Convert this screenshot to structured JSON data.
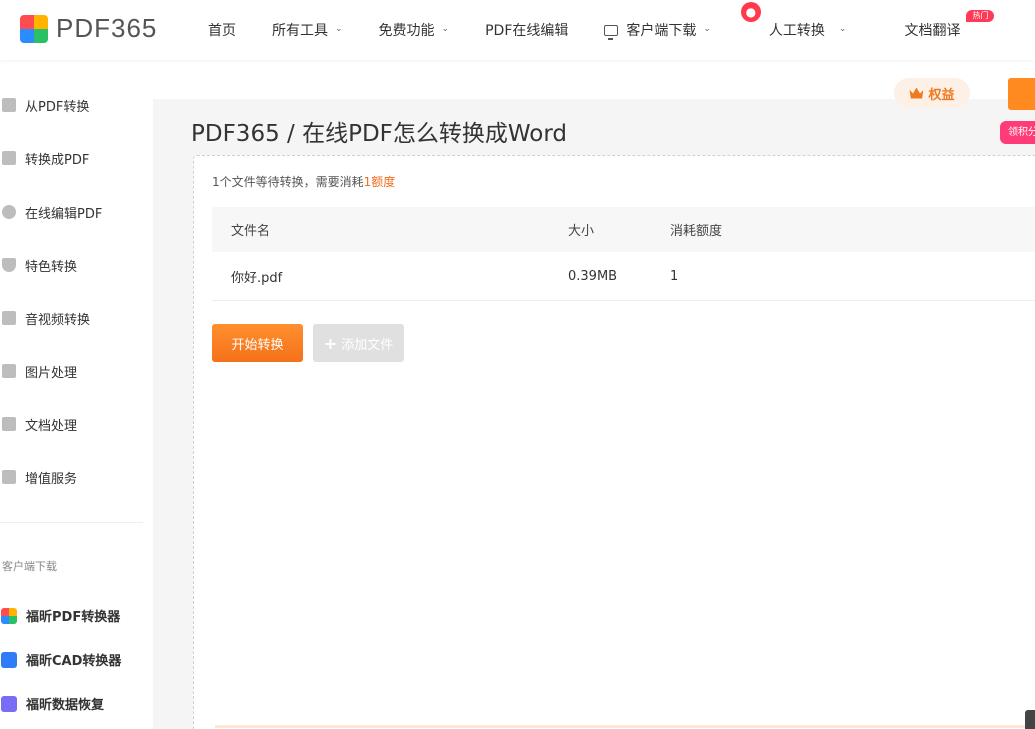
{
  "header": {
    "logo_text": "PDF365",
    "nav": [
      {
        "label": "首页",
        "chevron": false
      },
      {
        "label": "所有工具",
        "chevron": true
      },
      {
        "label": "免费功能",
        "chevron": true
      },
      {
        "label": "PDF在线编辑",
        "chevron": false
      },
      {
        "label": "客户端下载",
        "chevron": true
      },
      {
        "label": "人工转换",
        "chevron": true
      },
      {
        "label": "文档翻译",
        "chevron": false
      }
    ],
    "hot_badge": "热门"
  },
  "sidebar": {
    "items": [
      {
        "label": "从PDF转换",
        "icon": "pdf-convert-icon"
      },
      {
        "label": "转换成PDF",
        "icon": "to-pdf-icon"
      },
      {
        "label": "在线编辑PDF",
        "icon": "edit-pdf-icon"
      },
      {
        "label": "特色转换",
        "icon": "shield-icon"
      },
      {
        "label": "音视频转换",
        "icon": "media-icon"
      },
      {
        "label": "图片处理",
        "icon": "image-icon"
      },
      {
        "label": "文档处理",
        "icon": "document-icon"
      },
      {
        "label": "增值服务",
        "icon": "list-icon"
      }
    ],
    "download_section": "客户端下载",
    "apps": [
      {
        "label": "福昕PDF转换器",
        "icon": "pdf-converter-app-icon"
      },
      {
        "label": "福昕CAD转换器",
        "icon": "cad-converter-app-icon"
      },
      {
        "label": "福昕数据恢复",
        "icon": "data-recovery-app-icon"
      }
    ]
  },
  "top_actions": {
    "quanyi_label": "权益",
    "pink_tab_label": "领积分"
  },
  "main": {
    "title": "PDF365 / 在线PDF怎么转换成Word",
    "notice_prefix": "1个文件等待转换，需要消耗",
    "notice_highlight": "1额度",
    "table": {
      "headers": [
        "文件名",
        "大小",
        "消耗额度"
      ],
      "rows": [
        {
          "name": "你好.pdf",
          "size": "0.39MB",
          "cost": "1"
        }
      ]
    },
    "start_button": "开始转换",
    "add_button": "添加文件"
  },
  "colors": {
    "accent": "#f4711a",
    "highlight": "#ef6c1f",
    "hot": "#ff3a56",
    "pink": "#ff3c78"
  }
}
